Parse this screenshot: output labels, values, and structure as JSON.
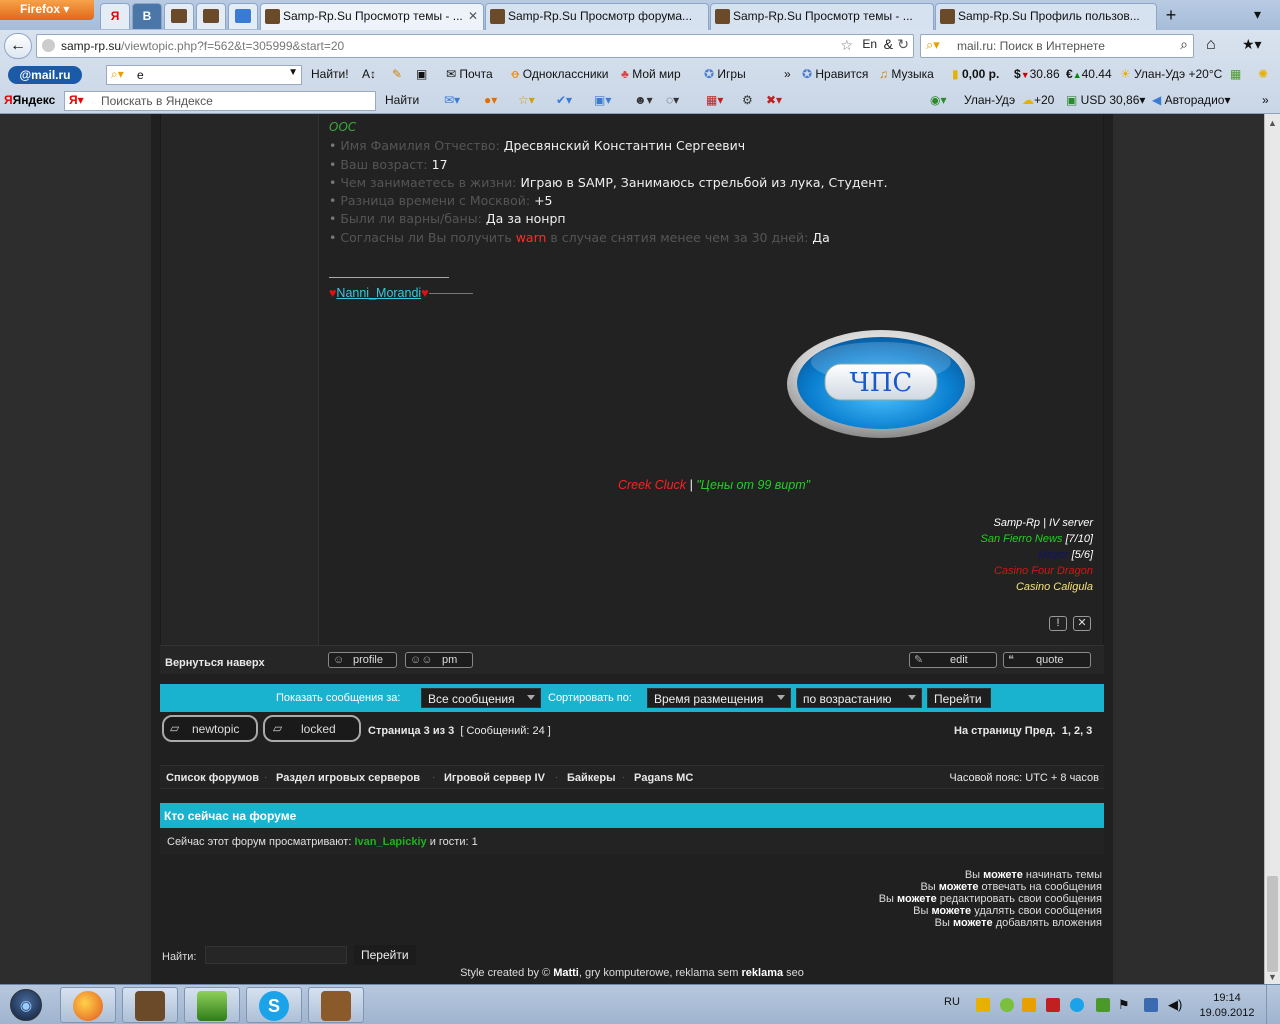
{
  "browser": {
    "app_button": "Firefox",
    "pinned_tabs": [
      "Я",
      "В"
    ],
    "tabs": [
      {
        "title": "Samp-Rp.Su Просмотр темы - ...",
        "active": true
      },
      {
        "title": "Samp-Rp.Su Просмотр форума...",
        "active": false
      },
      {
        "title": "Samp-Rp.Su Просмотр темы - ...",
        "active": false
      },
      {
        "title": "Samp-Rp.Su Профиль пользов...",
        "active": false
      }
    ],
    "url_host": "samp-rp.su",
    "url_path": "/viewtopic.php?f=562&t=305999&start=20",
    "search_placeholder": "mail.ru: Поиск в Интернете"
  },
  "mail_toolbar": {
    "logo": "@mail.ru",
    "query": "е",
    "find": "Найти!",
    "items": [
      "Почта",
      "Одноклассники",
      "Мой мир",
      "Игры",
      "Нравится",
      "Музыка",
      "0,00 р.",
      "30.86",
      "40.44",
      "Улан-Удэ +20°C"
    ]
  },
  "yandex_toolbar": {
    "logo": "Яндекс",
    "placeholder": "Поискать в Яндексе",
    "find": "Найти",
    "right_items": [
      "Улан-Удэ",
      "+20",
      "USD 30,86",
      "Авторадио"
    ]
  },
  "post": {
    "ooc": "OOC",
    "fields": [
      {
        "q": "Имя Фамилия Отчество:",
        "a": "Дресвянский Константин Сергеевич"
      },
      {
        "q": "Ваш возраст:",
        "a": "17"
      },
      {
        "q": "Чем занимаетесь в жизни:",
        "a": "Играю в SAMP, Занимаюсь стрельбой из лука, Студент."
      },
      {
        "q": "Разница времени с Москвой:",
        "a": "+5"
      },
      {
        "q": "Были ли варны/баны:",
        "a": "Да за нонрп"
      }
    ],
    "last_q1": "Согласны ли Вы получить",
    "last_warn": "warn",
    "last_q2": "в случае снятия менее чем за 30 дней:",
    "last_a": "Да",
    "sig_name": "Nanni_Morandi",
    "badge_text": "ЧПС",
    "creek": "Creek Cluck",
    "creek_sep": "|",
    "creek_slogan": "\"Цены от 99 вирт\"",
    "server_lines": [
      {
        "text": "Samp-Rp | IV server",
        "color": "#ffffff"
      },
      {
        "text": "San Fierro News",
        "extra": "[7/10]",
        "color": "#22d022"
      },
      {
        "text": "Mayor",
        "extra": "[5/6]",
        "color": "#12126a"
      },
      {
        "text": "Casino Four Dragon",
        "color": "#e01010"
      },
      {
        "text": "Casino Caligula",
        "color": "#f5e27a"
      }
    ]
  },
  "post_footer": {
    "back_to_top": "Вернуться наверх",
    "profile": "profile",
    "pm": "pm",
    "edit": "edit",
    "quote": "quote"
  },
  "sort_bar": {
    "show_label": "Показать сообщения за:",
    "show_value": "Все сообщения",
    "sort_label": "Сортировать по:",
    "sort_value": "Время размещения",
    "order_value": "по возрастанию",
    "go": "Перейти"
  },
  "pagination": {
    "newtopic": "newtopic",
    "locked": "locked",
    "page_info": "Страница 3 из 3",
    "count": "[ Сообщений: 24 ]",
    "goto": "На страницу Пред.",
    "pages": "1, 2, 3"
  },
  "breadcrumbs": [
    "Список форумов",
    "Раздел игровых серверов",
    "Игровой сервер IV",
    "Байкеры",
    "Pagans MC"
  ],
  "timezone": "Часовой пояс: UTC + 8 часов",
  "who_online": {
    "title": "Кто сейчас на форуме",
    "text": "Сейчас этот форум просматривают:",
    "user": "Ivan_Lapickiy",
    "guests": "и гости: 1"
  },
  "permissions": [
    {
      "pre": "Вы",
      "b": "можете",
      "post": "начинать темы"
    },
    {
      "pre": "Вы",
      "b": "можете",
      "post": "отвечать на сообщения"
    },
    {
      "pre": "Вы",
      "b": "можете",
      "post": "редактировать свои сообщения"
    },
    {
      "pre": "Вы",
      "b": "можете",
      "post": "удалять свои сообщения"
    },
    {
      "pre": "Вы",
      "b": "можете",
      "post": "добавлять вложения"
    }
  ],
  "search": {
    "label": "Найти:",
    "button": "Перейти"
  },
  "credits": {
    "pre": "Style created by ©",
    "author": "Matti",
    "mid": ", gry komputerowe, reklama sem",
    "b2": "reklama",
    "post": "seo"
  },
  "taskbar": {
    "lang": "RU",
    "time": "19:14",
    "date": "19.09.2012"
  },
  "colors": {
    "accent": "#19b3cf",
    "page_bg": "#202020",
    "ooc": "#3ca63c"
  }
}
